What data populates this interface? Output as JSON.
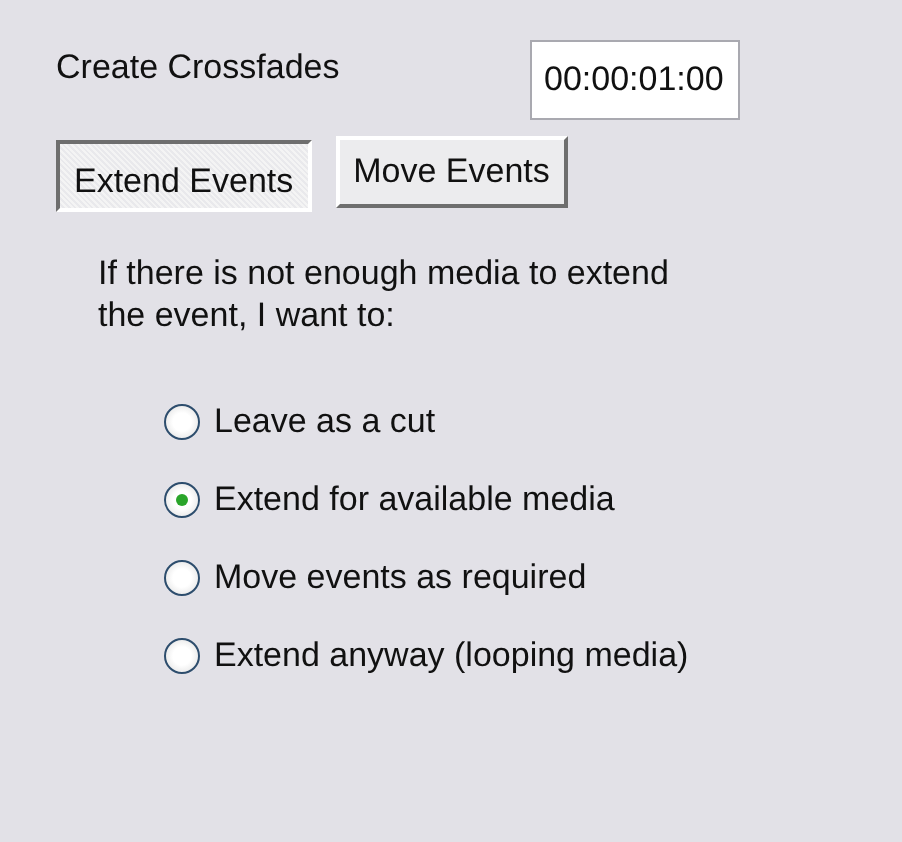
{
  "crossfade": {
    "label": "Create Crossfades",
    "value": "00:00:01:00"
  },
  "tabs": [
    {
      "label": "Extend Events",
      "selected": true
    },
    {
      "label": "Move Events",
      "selected": false
    }
  ],
  "instructions": "If there is not enough media to extend the event, I want to:",
  "options": [
    {
      "label": "Leave as a cut",
      "selected": false
    },
    {
      "label": "Extend for available media",
      "selected": true
    },
    {
      "label": "Move events as required",
      "selected": false
    },
    {
      "label": "Extend anyway (looping media)",
      "selected": false
    }
  ]
}
